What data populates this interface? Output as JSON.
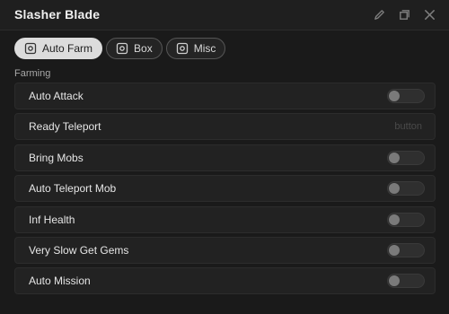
{
  "window": {
    "title": "Slasher Blade",
    "icons": [
      "pen-icon",
      "restore-icon",
      "close-icon"
    ]
  },
  "tabs": [
    {
      "label": "Auto Farm",
      "active": true,
      "icon": "tab-glyph-icon"
    },
    {
      "label": "Box",
      "active": false,
      "icon": "tab-glyph-icon"
    },
    {
      "label": "Misc",
      "active": false,
      "icon": "tab-glyph-icon"
    }
  ],
  "section": {
    "label": "Farming"
  },
  "rows": [
    {
      "label": "Auto Attack",
      "type": "toggle",
      "enabled": false
    },
    {
      "label": "Ready Teleport",
      "type": "button",
      "button_text": "button"
    },
    {
      "label": "Bring Mobs",
      "type": "toggle",
      "enabled": false
    },
    {
      "label": "Auto Teleport Mob",
      "type": "toggle",
      "enabled": false
    },
    {
      "label": "Inf Health",
      "type": "toggle",
      "enabled": false
    },
    {
      "label": "Very Slow Get Gems",
      "type": "toggle",
      "enabled": false
    },
    {
      "label": "Auto Mission",
      "type": "toggle",
      "enabled": false
    }
  ],
  "colors": {
    "background": "#1a1a1a",
    "active_tab": "#dcdcdc",
    "toggle_off": "#2f2f2f",
    "knob": "#7a7a7a"
  }
}
